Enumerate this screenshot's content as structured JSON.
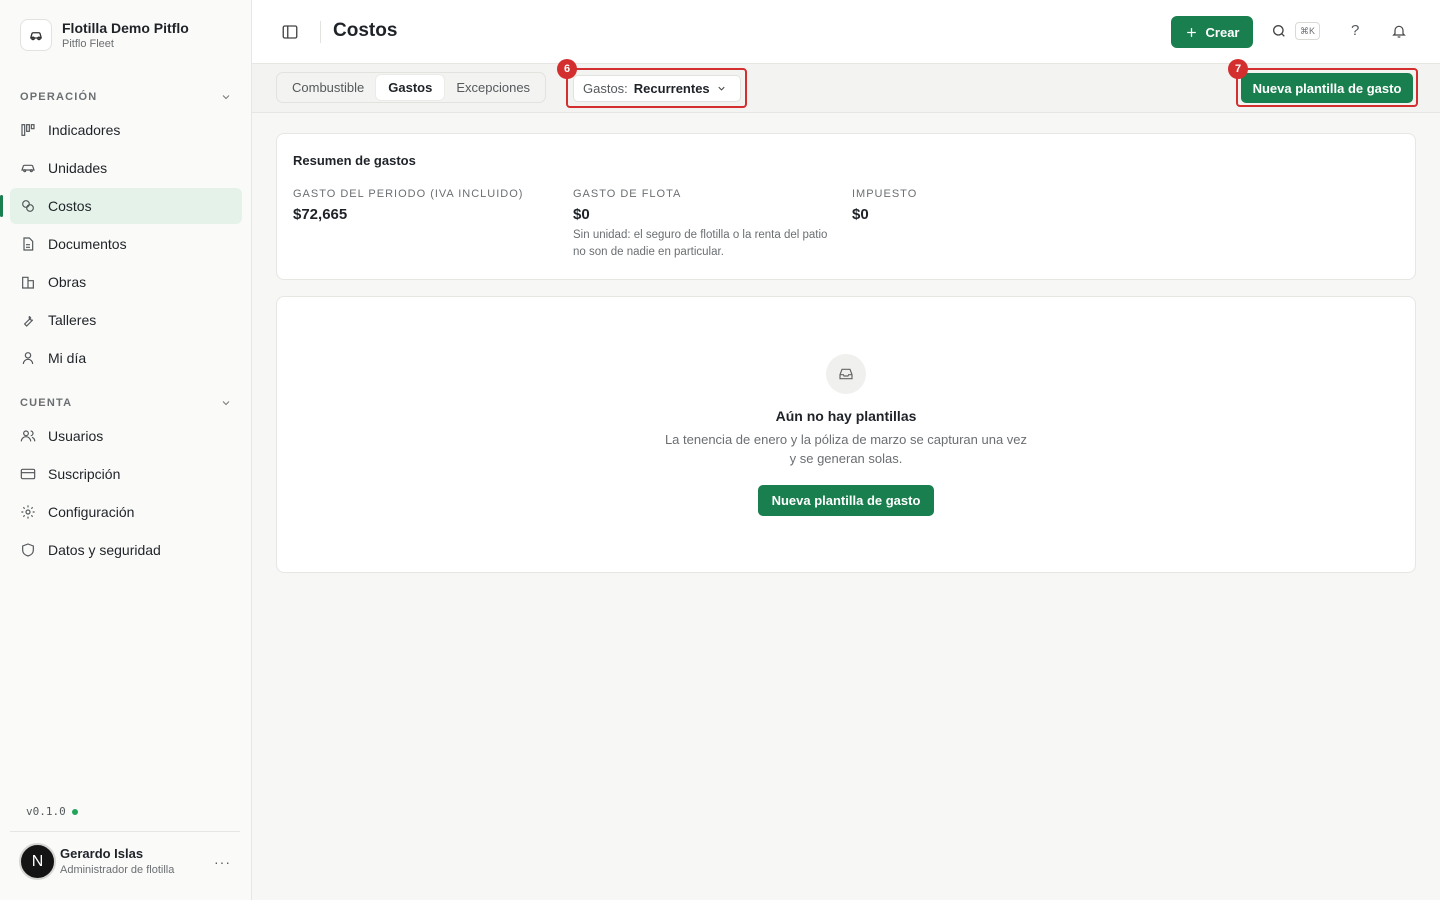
{
  "org": {
    "name": "Flotilla Demo Pitflo",
    "subtitle": "Pitflo Fleet"
  },
  "sidebar": {
    "operacion_label": "OPERACIÓN",
    "operacion_items": [
      {
        "label": "Indicadores",
        "icon": "kanban-icon"
      },
      {
        "label": "Unidades",
        "icon": "car-icon"
      },
      {
        "label": "Costos",
        "icon": "coins-icon",
        "active": true
      },
      {
        "label": "Documentos",
        "icon": "document-icon"
      },
      {
        "label": "Obras",
        "icon": "building-icon"
      },
      {
        "label": "Talleres",
        "icon": "wrench-icon"
      },
      {
        "label": "Mi día",
        "icon": "user-icon"
      }
    ],
    "cuenta_label": "CUENTA",
    "cuenta_items": [
      {
        "label": "Usuarios",
        "icon": "users-icon"
      },
      {
        "label": "Suscripción",
        "icon": "credit-card-icon"
      },
      {
        "label": "Configuración",
        "icon": "gear-icon"
      },
      {
        "label": "Datos y seguridad",
        "icon": "shield-icon"
      }
    ],
    "version": "v0.1.0",
    "user": {
      "initial": "N",
      "name": "Gerardo Islas",
      "role": "Administrador de flotilla",
      "more": "···"
    }
  },
  "header": {
    "title": "Costos",
    "create_label": "Crear",
    "shortcut": "⌘K",
    "help": "?"
  },
  "tabs": {
    "items": [
      {
        "label": "Combustible"
      },
      {
        "label": "Gastos",
        "active": true
      },
      {
        "label": "Excepciones"
      }
    ],
    "filter_prefix": "Gastos:",
    "filter_value": "Recurrentes",
    "badge_filter": "6",
    "badge_new": "7",
    "new_template_label": "Nueva plantilla de gasto"
  },
  "summary": {
    "title": "Resumen de gastos",
    "stats": [
      {
        "label": "GASTO DEL PERIODO (IVA INCLUIDO)",
        "value": "$72,665",
        "note": ""
      },
      {
        "label": "GASTO DE FLOTA",
        "value": "$0",
        "note": "Sin unidad: el seguro de flotilla o la renta del patio no son de nadie en particular."
      },
      {
        "label": "IMPUESTO",
        "value": "$0",
        "note": ""
      }
    ]
  },
  "empty": {
    "title": "Aún no hay plantillas",
    "text": "La tenencia de enero y la póliza de marzo se capturan una vez y se generan solas.",
    "button": "Nueva plantilla de gasto"
  },
  "colors": {
    "accent": "#1a7f4e",
    "highlight": "#d32f2f",
    "active_bg": "#e5f2ea"
  }
}
